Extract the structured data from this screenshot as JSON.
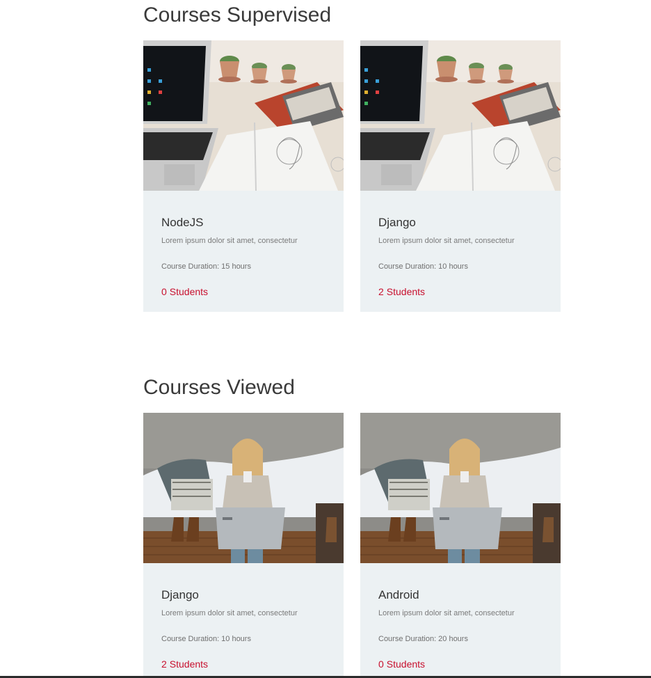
{
  "supervised": {
    "title": "Courses Supervised",
    "courses": [
      {
        "name": "NodeJS",
        "description": "Lorem ipsum dolor sit amet, consectetur",
        "duration_label": "Course Duration:",
        "duration_value": "15 hours",
        "students_count": "0",
        "students_label": "Students",
        "image": "laptop-desk-sketchbook-photo"
      },
      {
        "name": "Django",
        "description": "Lorem ipsum dolor sit amet, consectetur",
        "duration_label": "Course Duration:",
        "duration_value": "10 hours",
        "students_count": "2",
        "students_label": "Students",
        "image": "laptop-desk-sketchbook-photo"
      }
    ]
  },
  "viewed": {
    "title": "Courses Viewed",
    "courses": [
      {
        "name": "Django",
        "description": "Lorem ipsum dolor sit amet, consectetur",
        "duration_label": "Course Duration:",
        "duration_value": "10 hours",
        "students_count": "2",
        "students_label": "Students",
        "image": "woman-with-laptop-photo"
      },
      {
        "name": "Android",
        "description": "Lorem ipsum dolor sit amet, consectetur",
        "duration_label": "Course Duration:",
        "duration_value": "20 hours",
        "students_count": "0",
        "students_label": "Students",
        "image": "woman-with-laptop-photo"
      }
    ]
  },
  "colors": {
    "accent": "#c8102e",
    "card_background": "#ecf1f3",
    "heading": "#3a3a3a"
  }
}
